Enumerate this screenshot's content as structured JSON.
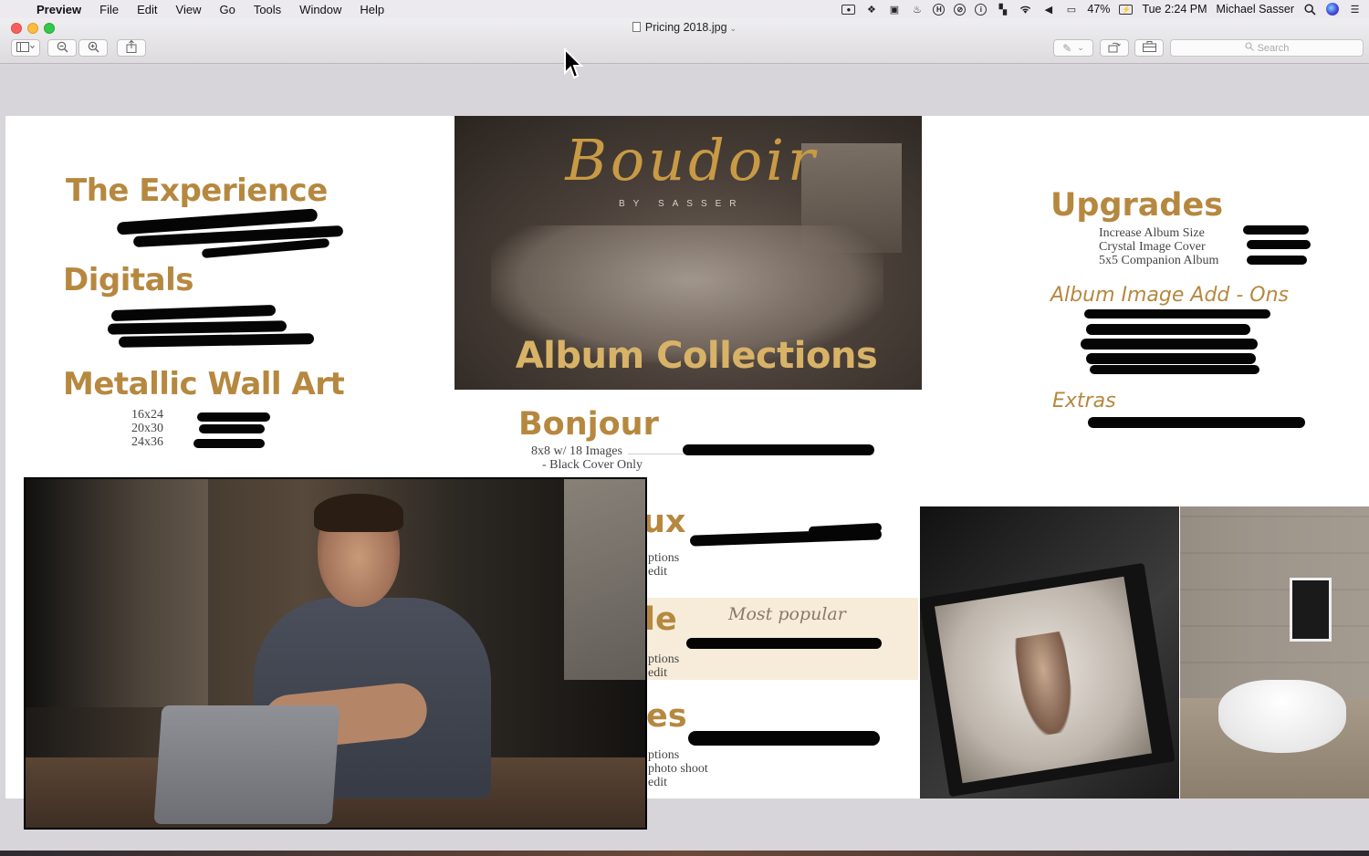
{
  "menubar": {
    "app_name": "Preview",
    "items": [
      "File",
      "Edit",
      "View",
      "Go",
      "Tools",
      "Window",
      "Help"
    ],
    "battery": "47%",
    "clock": "Tue 2:24 PM",
    "user": "Michael Sasser"
  },
  "window": {
    "title": "Pricing 2018.jpg",
    "search_placeholder": "Search"
  },
  "doc": {
    "left": {
      "experience_title": "The Experience",
      "digitals_title": "Digitals",
      "metallic_title": "Metallic Wall Art",
      "sizes": [
        "16x24",
        "20x30",
        "24x36"
      ]
    },
    "center": {
      "brand_script": "Boudoir",
      "brand_sub": "BY SASSER",
      "album_title": "Album Collections",
      "bonjour_title": "Bonjour",
      "bonjour_lines": [
        "8x8 w/ 18 Images",
        "- Black Cover Only"
      ],
      "pkg2_title_partial": "ux",
      "pkg2_lines": [
        "ptions",
        "edit"
      ],
      "pkg3_title_partial": "le",
      "pkg3_lines": [
        "ptions",
        "edit"
      ],
      "pkg4_title_partial": "es",
      "pkg4_lines": [
        "ptions",
        "photo shoot",
        "edit"
      ],
      "most_popular": "Most popular"
    },
    "right": {
      "upgrades_title": "Upgrades",
      "upgrades_lines": [
        "Increase Album Size",
        "Crystal Image Cover",
        "5x5 Companion Album"
      ],
      "addons_title": "Album Image Add - Ons",
      "extras_title": "Extras"
    }
  }
}
